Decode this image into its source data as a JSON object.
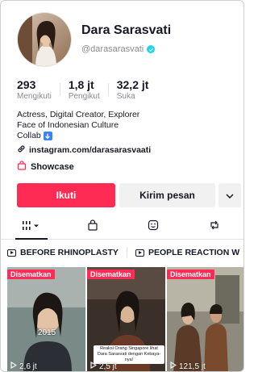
{
  "profile": {
    "display_name": "Dara Sarasvati",
    "handle": "@darasarasvati",
    "verified": true
  },
  "stats": [
    {
      "value": "293",
      "label": "Mengikuti"
    },
    {
      "value": "1,8 jt",
      "label": "Pengikut"
    },
    {
      "value": "32,2 jt",
      "label": "Suka"
    }
  ],
  "bio": {
    "line1": "Actress, Digital Creator, Explorer",
    "line2": "Face of Indonesian Culture",
    "line3": "Collab",
    "line3_emoji": "down-arrow-emoji"
  },
  "link": {
    "icon": "link-icon",
    "text": "instagram.com/darasarasvaati"
  },
  "showcase": {
    "icon": "shopping-bag-icon",
    "label": "Showcase"
  },
  "actions": {
    "follow_label": "Ikuti",
    "message_label": "Kirim pesan",
    "more_icon": "chevron-down-icon"
  },
  "tabs": [
    {
      "icon": "videos-grid-icon",
      "active": true
    },
    {
      "icon": "lock-bag-icon",
      "active": false
    },
    {
      "icon": "favorites-icon",
      "active": false
    },
    {
      "icon": "repost-icon",
      "active": false
    }
  ],
  "playlists": [
    {
      "label": "BEFORE RHINOPLASTY"
    },
    {
      "label": "PEOPLE REACTION W"
    }
  ],
  "videos": [
    {
      "pinned_label": "Disematkan",
      "views": "2,6 jt",
      "overlay": "2015",
      "caption": ""
    },
    {
      "pinned_label": "Disematkan",
      "views": "2,5 jt",
      "overlay": "",
      "caption": "Reaksi Orang Singapore lihat Dara Sarasvati dengan Kebaya-nya!"
    },
    {
      "pinned_label": "Disematkan",
      "views": "121,5 jt",
      "overlay": "",
      "caption": ""
    }
  ],
  "colors": {
    "accent": "#fe2c55",
    "verified": "#20d5ec",
    "text_primary": "#161823",
    "text_secondary": "#8a8b91"
  }
}
